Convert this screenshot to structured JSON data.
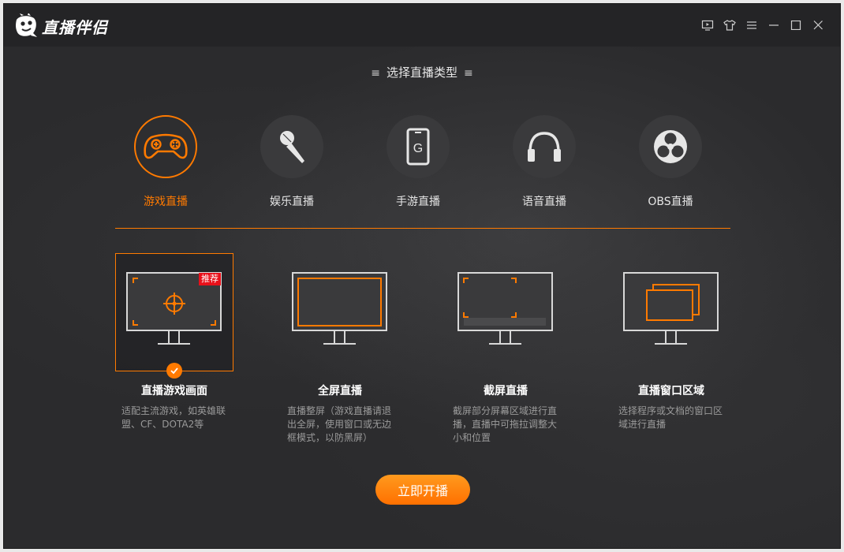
{
  "app": {
    "title": "直播伴侣"
  },
  "window_controls": [
    "tv-icon",
    "shirt-icon",
    "menu-icon",
    "minimize-icon",
    "maximize-icon",
    "close-icon"
  ],
  "section_title": "选择直播类型",
  "live_types": [
    {
      "label": "游戏直播",
      "icon": "gamepad-icon",
      "active": true
    },
    {
      "label": "娱乐直播",
      "icon": "microphone-icon",
      "active": false
    },
    {
      "label": "手游直播",
      "icon": "phone-icon",
      "active": false
    },
    {
      "label": "语音直播",
      "icon": "headphones-icon",
      "active": false
    },
    {
      "label": "OBS直播",
      "icon": "obs-icon",
      "active": false
    }
  ],
  "capture_modes": [
    {
      "title": "直播游戏画面",
      "desc": "适配主流游戏，如英雄联盟、CF、DOTA2等",
      "badge": "推荐",
      "selected": true
    },
    {
      "title": "全屏直播",
      "desc": "直播整屏（游戏直播请退出全屏，使用窗口或无边框模式，以防黑屏）",
      "selected": false
    },
    {
      "title": "截屏直播",
      "desc": "截屏部分屏幕区域进行直播，直播中可拖拉调整大小和位置",
      "selected": false
    },
    {
      "title": "直播窗口区域",
      "desc": "选择程序或文档的窗口区域进行直播",
      "selected": false
    }
  ],
  "start_button": "立即开播",
  "colors": {
    "accent": "#ff7a00",
    "background": "#2b2b2d",
    "badge": "#e8101a"
  }
}
